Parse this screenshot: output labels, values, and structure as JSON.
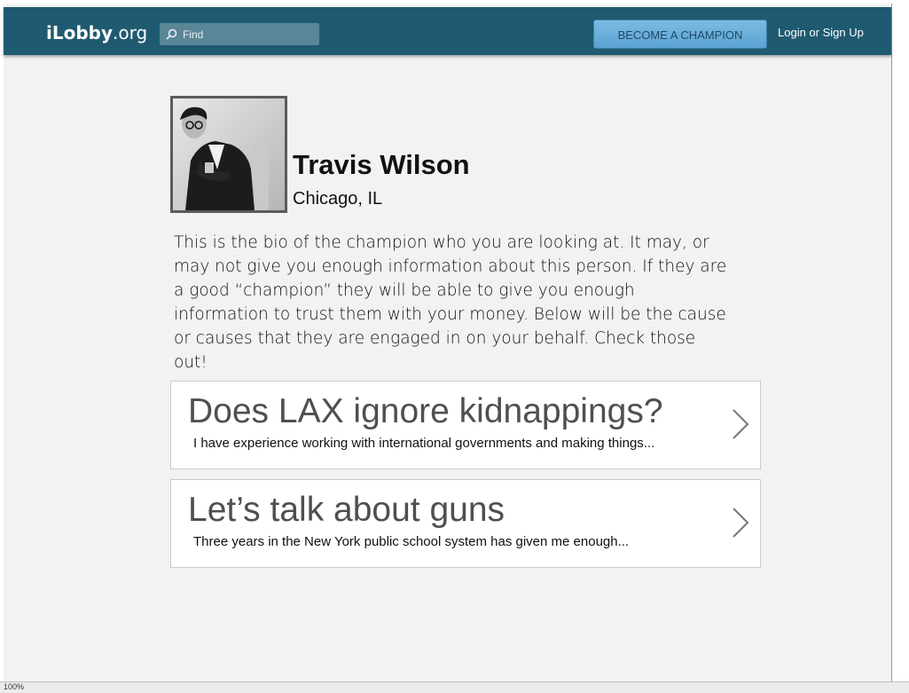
{
  "header": {
    "logo_main": "iLobby",
    "logo_tld": ".org",
    "search_placeholder": "Find",
    "cta_label": "BECOME A CHAMPION",
    "login_label": "Login or Sign Up"
  },
  "profile": {
    "name": "Travis Wilson",
    "location": "Chicago, IL",
    "bio": "This is the bio of the champion who you are looking at.  It may, or may not give you enough information about this person.  If they are a good “champion” they will be able to give you enough information to trust them with your money.  Below will be the cause or causes that they are engaged in on your behalf.  Check those out!"
  },
  "causes": [
    {
      "title": "Does LAX ignore kidnappings?",
      "summary": "I have experience working with international governments and making things..."
    },
    {
      "title": "Let’s talk about guns",
      "summary": "Three years in the New York public school system has given me enough..."
    }
  ],
  "statusbar": {
    "zoom": "100%"
  },
  "colors": {
    "topbar": "#1f5a70",
    "cta": "#5aa2d1",
    "page_bg": "#f2f2f2"
  }
}
